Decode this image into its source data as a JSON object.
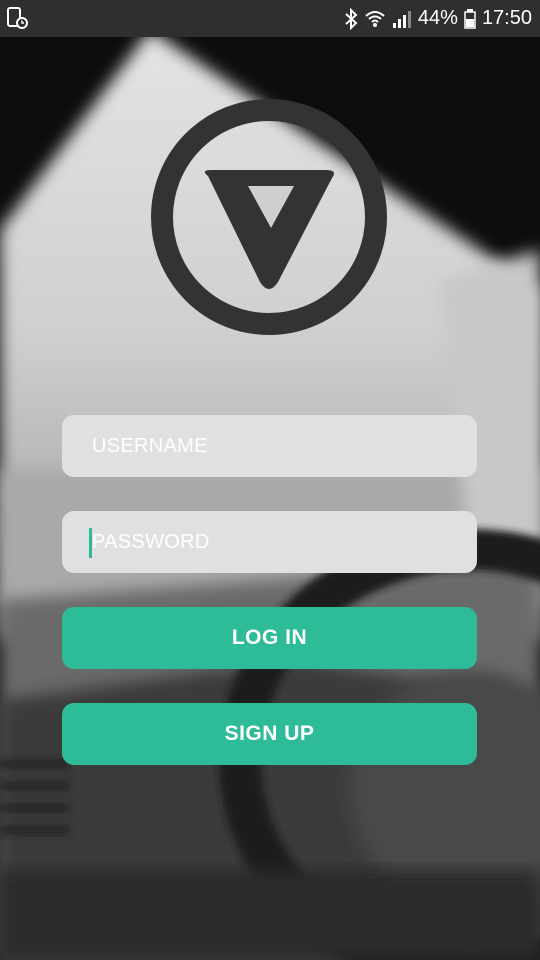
{
  "status_bar": {
    "battery": "44%",
    "time": "17:50",
    "icons": [
      "alarm-icon",
      "bluetooth-icon",
      "wifi-icon",
      "signal-icon",
      "battery-icon"
    ]
  },
  "logo": {
    "icon": "v-triangle-circle-logo",
    "color": "#333333"
  },
  "form": {
    "username_placeholder": "USERNAME",
    "username_value": "",
    "password_placeholder": "PASSWORD",
    "password_value": ""
  },
  "buttons": {
    "login_label": "LOG IN",
    "signup_label": "SIGN UP"
  },
  "colors": {
    "accent": "#2ebb97",
    "field_bg": "#dfe0e2",
    "status_bar_bg": "#2f2f2f"
  }
}
